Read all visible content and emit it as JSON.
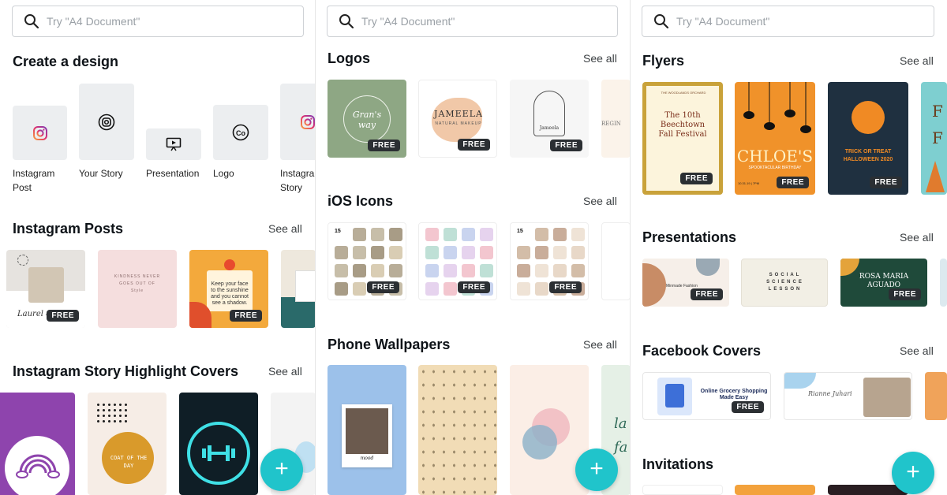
{
  "search": {
    "placeholder": "Try \"A4 Document\""
  },
  "see_all": "See all",
  "free_badge": "FREE",
  "panel1": {
    "create_title": "Create a design",
    "design_types": [
      {
        "label": "Instagram Post",
        "icon": "instagram-icon"
      },
      {
        "label": "Your Story",
        "icon": "story-icon"
      },
      {
        "label": "Presentation",
        "icon": "presentation-icon"
      },
      {
        "label": "Logo",
        "icon": "logo-co-icon"
      },
      {
        "label": "Instagram Story",
        "icon": "instagram-icon"
      }
    ],
    "instagram_posts": {
      "title": "Instagram Posts",
      "t1_text": "Laurel &",
      "t2_text": "KINDNESS NEVER GOES OUT OF Style",
      "t3_text": "Keep your face to the sunshine and you cannot see a shadow."
    },
    "highlights": {
      "title": "Instagram Story Highlight Covers",
      "t2_text": "COAT OF THE DAY"
    }
  },
  "panel2": {
    "logos": {
      "title": "Logos",
      "t1_text": "Gran's way",
      "t2_text": "JAMEELA",
      "t2_sub": "NATURAL MAKEUP",
      "t3_text": "Jameela",
      "t4_text": "REGIN"
    },
    "ios_icons": {
      "title": "iOS Icons",
      "t1_time": "15",
      "t3_time": "15"
    },
    "wallpapers": {
      "title": "Phone Wallpapers",
      "t1_caption": "mood",
      "t4_text": "la fa"
    }
  },
  "panel3": {
    "flyers": {
      "title": "Flyers",
      "t1_text": "The 10th Beechtown Fall Festival",
      "t1_top": "THE WOODLANDS ORCHARD",
      "t2_text": "CHLOE'S",
      "t2_sub": "SPOOKTACULAR BIRTHDAY",
      "t2_date": "10.31.19 | 7PM",
      "t3_text": "TRICK OR TREAT HALLOWEEN 2020",
      "t4_text": "F F"
    },
    "presentations": {
      "title": "Presentations",
      "t1_text": "Minmade Fashion",
      "t2_text": "SOCIAL SCIENCE LESSON",
      "t3_text": "ROSA MARIA AGUADO"
    },
    "facebook_covers": {
      "title": "Facebook Covers",
      "t1_text": "Online Grocery Shopping Made Easy",
      "t2_text": "Rianne Juhari"
    },
    "invitations": {
      "title": "Invitations"
    }
  },
  "colors": {
    "accent": "#20c4cb",
    "badge": "#2b2f33"
  }
}
